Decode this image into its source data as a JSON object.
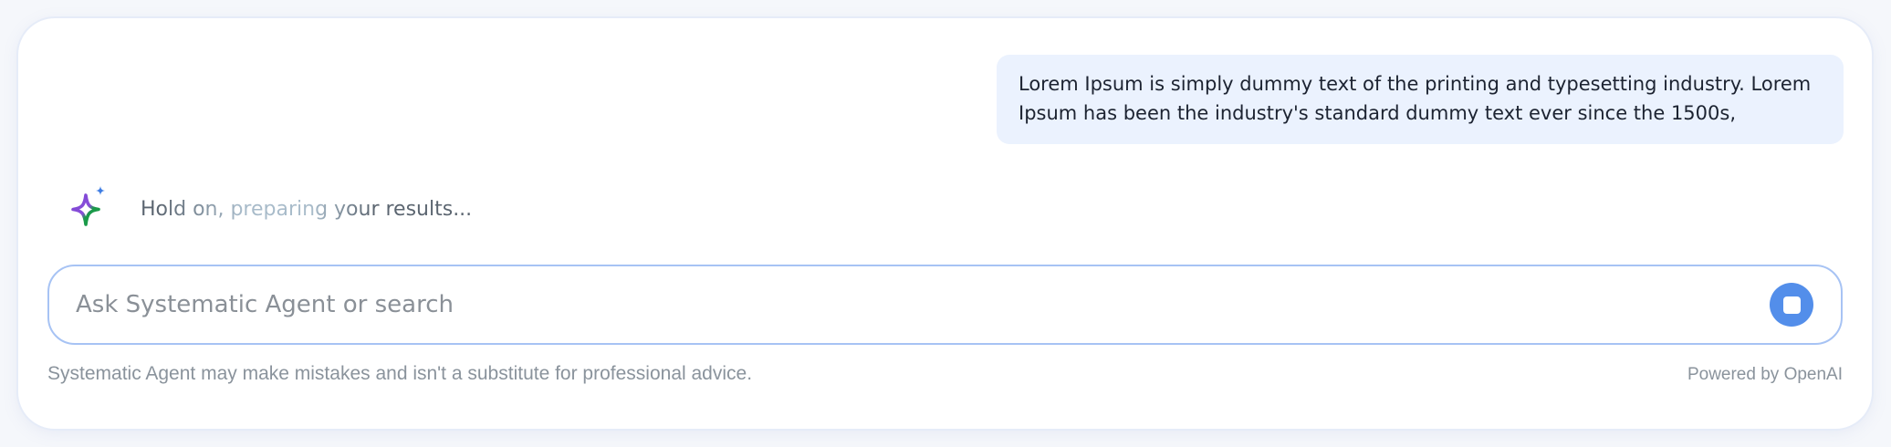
{
  "conversation": {
    "user_message": "Lorem Ipsum is simply dummy text of the printing and typesetting industry. Lorem Ipsum has been the industry's standard dummy text ever since the 1500s,"
  },
  "agent": {
    "icon": "sparkle-icon",
    "status_text": "Hold on, preparing your results..."
  },
  "composer": {
    "placeholder": "Ask Systematic Agent or search",
    "value": "",
    "stop_icon": "stop-icon"
  },
  "footer": {
    "disclaimer": "Systematic Agent may make mistakes and isn't a substitute for professional advice.",
    "powered_by": "Powered by OpenAI"
  },
  "colors": {
    "accent": "#538eea",
    "user_bubble_bg": "#ebf2fe",
    "input_border": "#a7c3f4",
    "sparkle_purple": "#7b44d6",
    "sparkle_green": "#1a9a49",
    "sparkle_blue": "#3e7de3"
  }
}
